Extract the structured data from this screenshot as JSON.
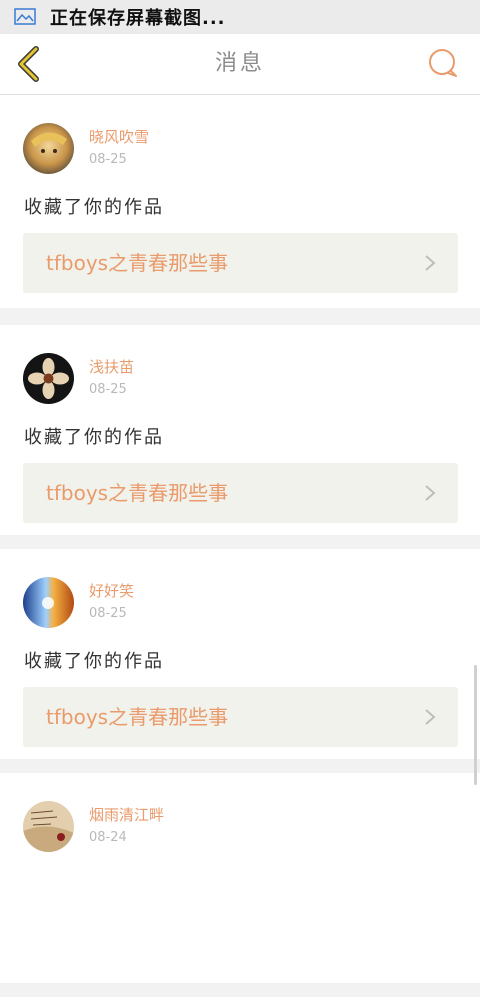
{
  "status_bar": {
    "text": "正在保存屏幕截图...",
    "icon": "screenshot-icon"
  },
  "header": {
    "title": "消息",
    "back_icon": "back-chevron-icon",
    "chat_icon": "chat-bubble-icon"
  },
  "colors": {
    "accent": "#e99b6c",
    "back": "#c9a82a",
    "card_bg": "#f2f2ec"
  },
  "messages": [
    {
      "user": "晓风吹雪",
      "date": "08-25",
      "action": "收藏了你的作品",
      "work": "tfboys之青春那些事"
    },
    {
      "user": "浅扶苗",
      "date": "08-25",
      "action": "收藏了你的作品",
      "work": "tfboys之青春那些事"
    },
    {
      "user": "好好笑",
      "date": "08-25",
      "action": "收藏了你的作品",
      "work": "tfboys之青春那些事"
    },
    {
      "user": "烟雨清江畔",
      "date": "08-24",
      "action": "",
      "work": ""
    }
  ]
}
